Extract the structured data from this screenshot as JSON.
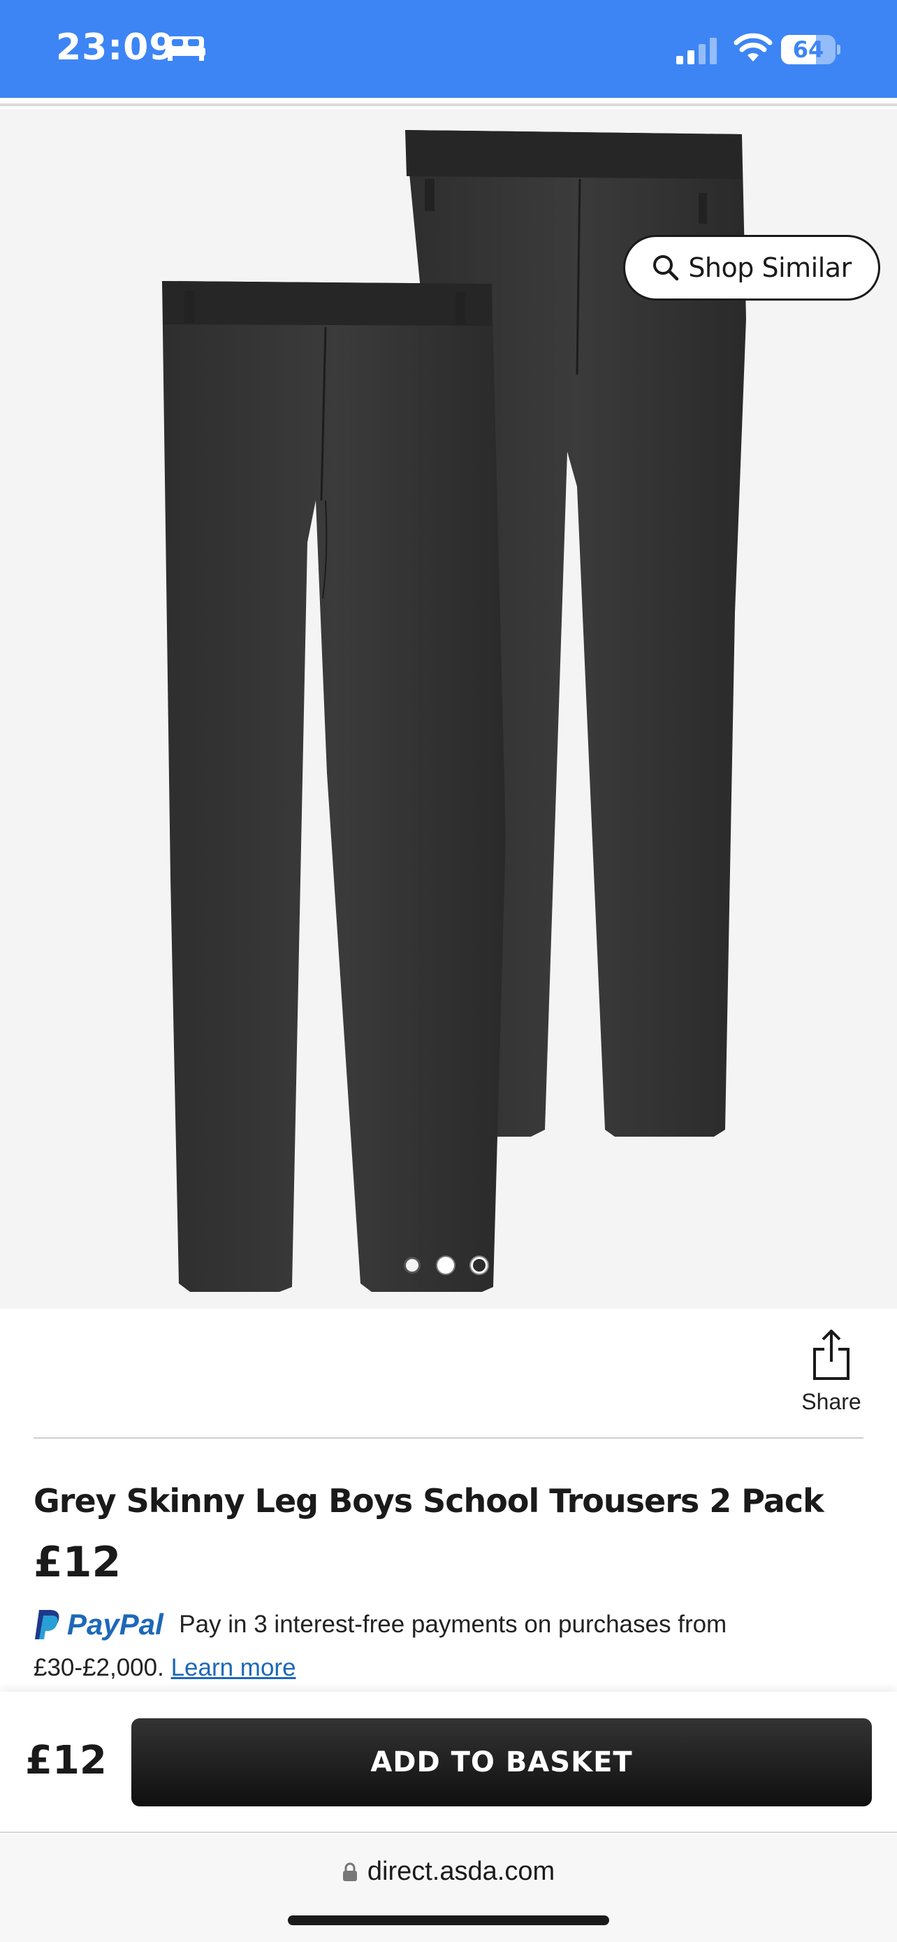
{
  "status_bar": {
    "time": "23:09",
    "battery_level": "64",
    "battery_fraction": 0.64,
    "icons": [
      "bed-icon",
      "cellular-signal-icon",
      "wifi-icon",
      "battery-icon"
    ],
    "background_color": "#3d85f5"
  },
  "product_gallery": {
    "shop_similar_label": "Shop Similar",
    "slide_count": 3,
    "active_slide": 2,
    "wishlist_icon": "heart-icon"
  },
  "share": {
    "label": "Share",
    "icon": "share-icon"
  },
  "product": {
    "title": "Grey Skinny Leg Boys School Trousers 2 Pack",
    "price": "£12"
  },
  "paypal": {
    "brand": "PayPal",
    "message": "Pay in 3 interest-free payments on purchases from",
    "range": "£30-£2,000.",
    "link_label": "Learn more",
    "brand_color": "#1d68b8"
  },
  "basket_bar": {
    "price": "£12",
    "button_label": "ADD TO BASKET"
  },
  "browser": {
    "url": "direct.asda.com",
    "lock_icon": "lock-icon"
  }
}
